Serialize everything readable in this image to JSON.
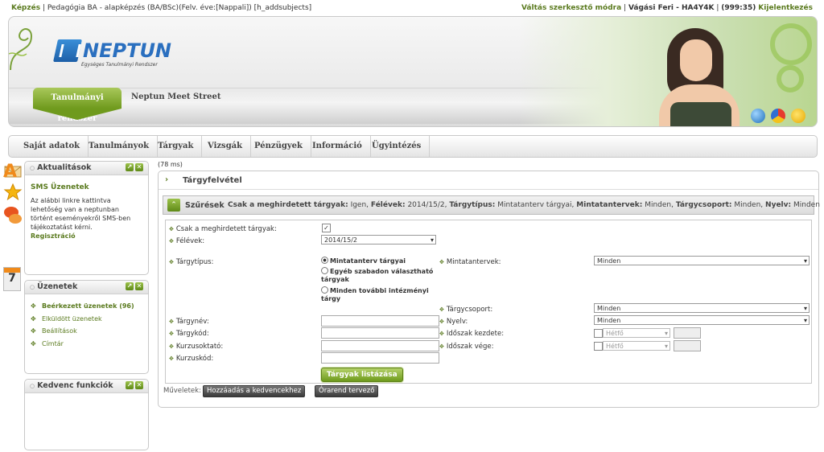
{
  "topbar": {
    "left_link": "Képzés",
    "left_text": "Pedagógia BA - alapképzés (BA/BSc)(Felv. éve:[Nappali]) [h_addsubjects]",
    "right_mode": "Váltás szerkesztő módra",
    "right_user": "Vágási Feri - HA4Y4K",
    "right_timer": "(999:35)",
    "right_logout": "Kijelentkezés"
  },
  "header": {
    "logo_name": "NEPTUN",
    "logo_sub": "Egységes Tanulmányi Rendszer",
    "tab_active": "Tanulmányi rendszer",
    "tab_other": "Neptun Meet Street"
  },
  "nav": {
    "items": [
      "Saját adatok",
      "Tanulmányok",
      "Tárgyak",
      "Vizsgák",
      "Pénzügyek",
      "Információ",
      "Ügyintézés"
    ]
  },
  "panels": {
    "news": {
      "title": "Aktualitások",
      "subtitle": "SMS Üzenetek",
      "body": "Az alábbi linkre kattintva lehetőség van a neptunban történt eseményekről SMS-ben tájékoztatást kérni.",
      "link": "Regisztráció"
    },
    "messages": {
      "title": "Üzenetek",
      "items": [
        "Beérkezett üzenetek (96)",
        "Elküldött üzenetek",
        "Beállítások",
        "Címtár"
      ]
    },
    "favorites": {
      "title": "Kedvenc funkciók"
    }
  },
  "main": {
    "timing": "(78 ms)",
    "title": "Tárgyfelvétel",
    "filter_label": "Szűrések",
    "filter_summary": [
      {
        "k": "Csak a meghirdetett tárgyak:",
        "v": "Igen,"
      },
      {
        "k": "Félévek:",
        "v": "2014/15/2,"
      },
      {
        "k": "Tárgytípus:",
        "v": "Mintatanterv tárgyai,"
      },
      {
        "k": "Mintatantervek:",
        "v": "Minden,"
      },
      {
        "k": "Tárgycsoport:",
        "v": "Minden,"
      },
      {
        "k": "Nyelv:",
        "v": "Minden"
      }
    ],
    "form": {
      "only_announced_label": "Csak a meghirdetett tárgyak:",
      "semester_label": "Félévek:",
      "semester_value": "2014/15/2",
      "type_label": "Tárgytípus:",
      "type_options": [
        "Mintatanterv tárgyai",
        "Egyéb szabadon választható tárgyak",
        "Minden további intézményi tárgy"
      ],
      "curricula_label": "Mintatantervek:",
      "curricula_value": "Minden",
      "group_label": "Tárgycsoport:",
      "group_value": "Minden",
      "name_label": "Tárgynév:",
      "code_label": "Tárgykód:",
      "teacher_label": "Kurzusoktató:",
      "course_code_label": "Kurzuskód:",
      "language_label": "Nyelv:",
      "language_value": "Minden",
      "period_start_label": "Időszak kezdete:",
      "period_end_label": "Időszak vége:",
      "day_value": "Hétfő",
      "list_button": "Tárgyak listázása"
    },
    "ops_label": "Műveletek:",
    "ops_buttons": [
      "Hozzáadás a kedvencekhez",
      "Órarend tervező"
    ]
  },
  "colors": {
    "accent_green": "#6f9a1d",
    "link_green": "#5a7a1e",
    "logo_blue": "#2a6fbf"
  }
}
